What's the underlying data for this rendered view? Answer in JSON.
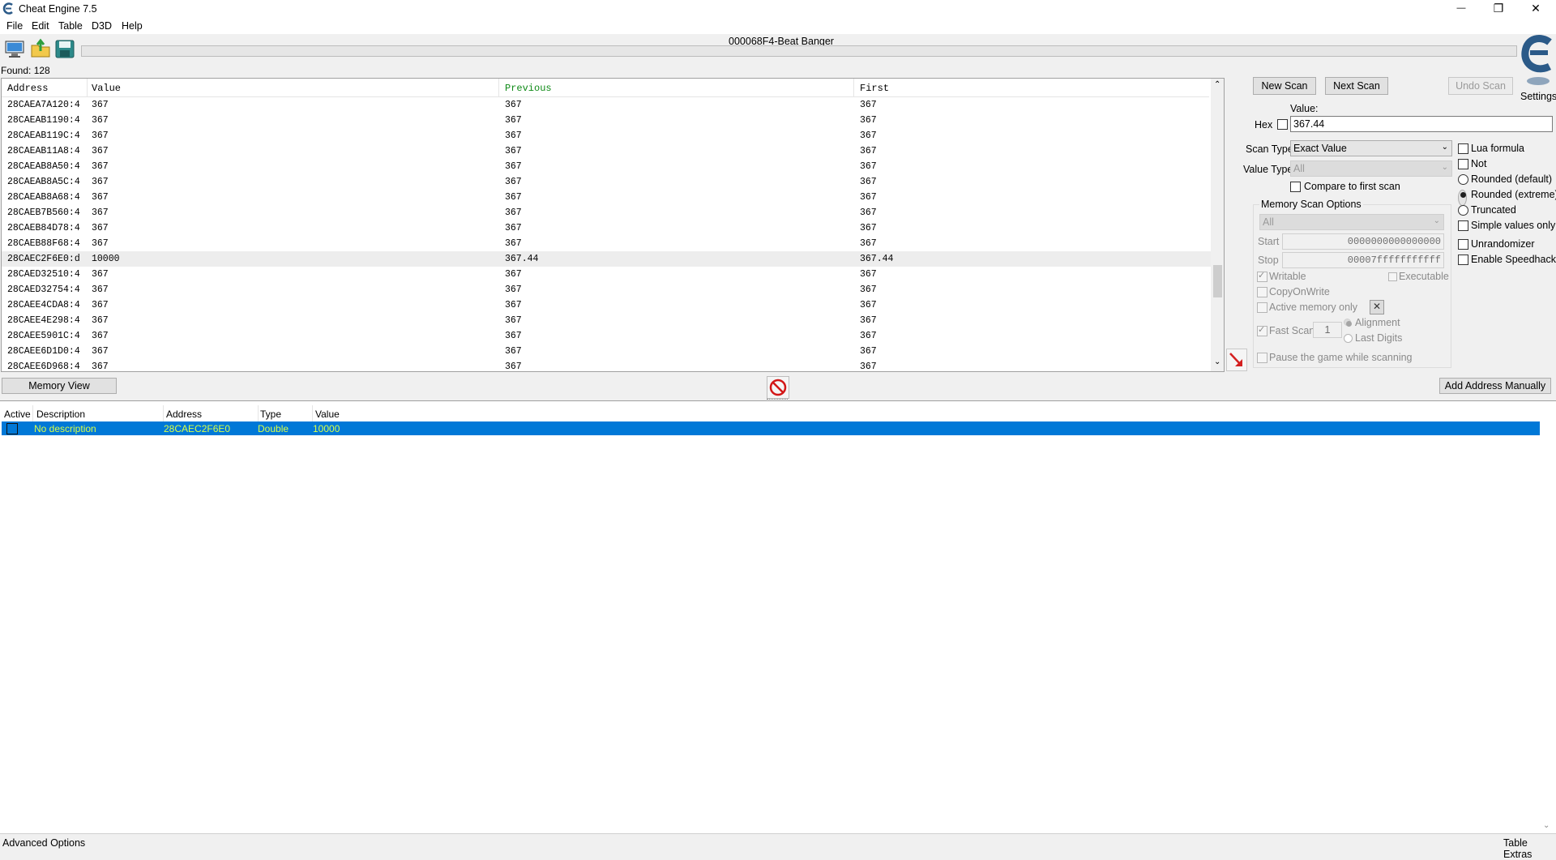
{
  "window": {
    "title": "Cheat Engine 7.5",
    "process": "000068F4-Beat Banger",
    "controls": {
      "minimize": "—",
      "restore": "❐",
      "close": "✕"
    }
  },
  "menu": [
    "File",
    "Edit",
    "Table",
    "D3D",
    "Help"
  ],
  "toolbar": {
    "icons": [
      "open-process-icon",
      "open-file-icon",
      "save-icon"
    ]
  },
  "found": "Found: 128",
  "results": {
    "columns": [
      "Address",
      "Value",
      "Previous",
      "First"
    ],
    "rows": [
      [
        "28CAEA7A120:4",
        "367",
        "367",
        "367"
      ],
      [
        "28CAEAB1190:4",
        "367",
        "367",
        "367"
      ],
      [
        "28CAEAB119C:4",
        "367",
        "367",
        "367"
      ],
      [
        "28CAEAB11A8:4",
        "367",
        "367",
        "367"
      ],
      [
        "28CAEAB8A50:4",
        "367",
        "367",
        "367"
      ],
      [
        "28CAEAB8A5C:4",
        "367",
        "367",
        "367"
      ],
      [
        "28CAEAB8A68:4",
        "367",
        "367",
        "367"
      ],
      [
        "28CAEB7B560:4",
        "367",
        "367",
        "367"
      ],
      [
        "28CAEB84D78:4",
        "367",
        "367",
        "367"
      ],
      [
        "28CAEB88F68:4",
        "367",
        "367",
        "367"
      ],
      [
        "28CAEC2F6E0:d",
        "10000",
        "367.44",
        "367.44"
      ],
      [
        "28CAED32510:4",
        "367",
        "367",
        "367"
      ],
      [
        "28CAED32754:4",
        "367",
        "367",
        "367"
      ],
      [
        "28CAEE4CDA8:4",
        "367",
        "367",
        "367"
      ],
      [
        "28CAEE4E298:4",
        "367",
        "367",
        "367"
      ],
      [
        "28CAEE5901C:4",
        "367",
        "367",
        "367"
      ],
      [
        "28CAEE6D1D0:4",
        "367",
        "367",
        "367"
      ],
      [
        "28CAEE6D968:4",
        "367",
        "367",
        "367"
      ]
    ]
  },
  "scan": {
    "new_scan": "New Scan",
    "next_scan": "Next Scan",
    "undo_scan": "Undo Scan",
    "settings": "Settings",
    "value_label": "Value:",
    "hex_label": "Hex",
    "value": "367.44",
    "scan_type_label": "Scan Type",
    "scan_type": "Exact Value",
    "value_type_label": "Value Type",
    "value_type": "All",
    "compare_first": "Compare to first scan",
    "lua_formula": "Lua formula",
    "not": "Not",
    "rounded_default": "Rounded (default)",
    "rounded_extreme": "Rounded (extreme)",
    "truncated": "Truncated",
    "simple_values": "Simple values only",
    "unrandomizer": "Unrandomizer",
    "speedhack": "Enable Speedhack"
  },
  "memory": {
    "title": "Memory Scan Options",
    "region": "All",
    "start_label": "Start",
    "start": "0000000000000000",
    "stop_label": "Stop",
    "stop": "00007fffffffffff",
    "writable": "Writable",
    "executable": "Executable",
    "copy_on_write": "CopyOnWrite",
    "active_only": "Active memory only",
    "fast_scan": "Fast Scan",
    "fast_scan_value": "1",
    "alignment": "Alignment",
    "last_digits": "Last Digits",
    "pause_game": "Pause the game while scanning"
  },
  "mid": {
    "memory_view": "Memory View",
    "add_address": "Add Address Manually"
  },
  "addrlist": {
    "columns": [
      "Active",
      "Description",
      "Address",
      "Type",
      "Value"
    ],
    "row": {
      "description": "No description",
      "address": "28CAEC2F6E0",
      "type": "Double",
      "value": "10000"
    }
  },
  "status": {
    "left": "Advanced Options",
    "right": "Table Extras"
  }
}
